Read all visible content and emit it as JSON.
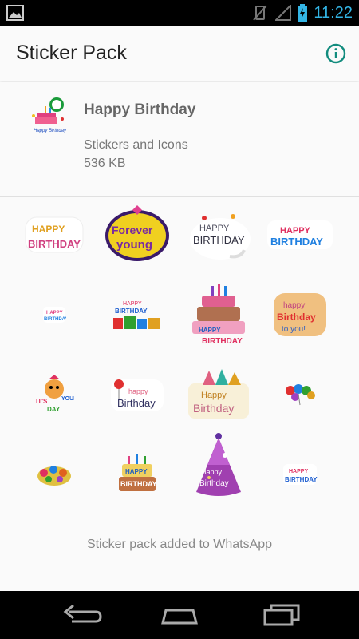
{
  "status_bar": {
    "time": "11:22",
    "icons": [
      "image-icon",
      "vibrate-off-icon",
      "signal-icon",
      "battery-icon"
    ]
  },
  "app_bar": {
    "title": "Sticker Pack",
    "info_icon": "info-icon"
  },
  "pack": {
    "name": "Happy Birthday",
    "publisher": "Stickers and Icons",
    "size": "536 KB",
    "tray_icon": "birthday-cake-icon"
  },
  "stickers": [
    {
      "name": "sticker-happy-birthday-1",
      "text": "HAPPY BIRTHDAY"
    },
    {
      "name": "sticker-forever-young",
      "text": "Forever young"
    },
    {
      "name": "sticker-happy-birthday-2",
      "text": "HAPPY BIRTHDAY"
    },
    {
      "name": "sticker-happy-birthday-3",
      "text": "HAPPY BIRTHDAY"
    },
    {
      "name": "sticker-happy-birthday-4",
      "text": "HAPPY BIRTHDAY"
    },
    {
      "name": "sticker-happy-birthday-gifts",
      "text": "HAPPY BIRTHDAY"
    },
    {
      "name": "sticker-birthday-cake",
      "text": "HAPPY BIRTHDAY"
    },
    {
      "name": "sticker-happy-birthday-to-you",
      "text": "happy Birthday to you!"
    },
    {
      "name": "sticker-its-your-day",
      "text": "IT'S YOUR DAY"
    },
    {
      "name": "sticker-happy-birthday-balloon",
      "text": "happy Birthday"
    },
    {
      "name": "sticker-happy-birthday-hats",
      "text": "Happy Birthday"
    },
    {
      "name": "sticker-balloons",
      "text": ""
    },
    {
      "name": "sticker-flowers",
      "text": ""
    },
    {
      "name": "sticker-birthday-cake-small",
      "text": "HAPPY BIRTHDAY"
    },
    {
      "name": "sticker-party-hat",
      "text": "Happy Birthday"
    },
    {
      "name": "sticker-happy-birthday-5",
      "text": "HAPPY BIRTHDAY"
    }
  ],
  "footer": {
    "status": "Sticker pack added to WhatsApp"
  },
  "nav_bar": {
    "buttons": [
      "back-icon",
      "home-icon",
      "recents-icon"
    ]
  },
  "colors": {
    "status_bar_bg": "#000000",
    "status_accent": "#33b5e5",
    "info_icon": "#128c7e",
    "background": "#fafafa"
  }
}
